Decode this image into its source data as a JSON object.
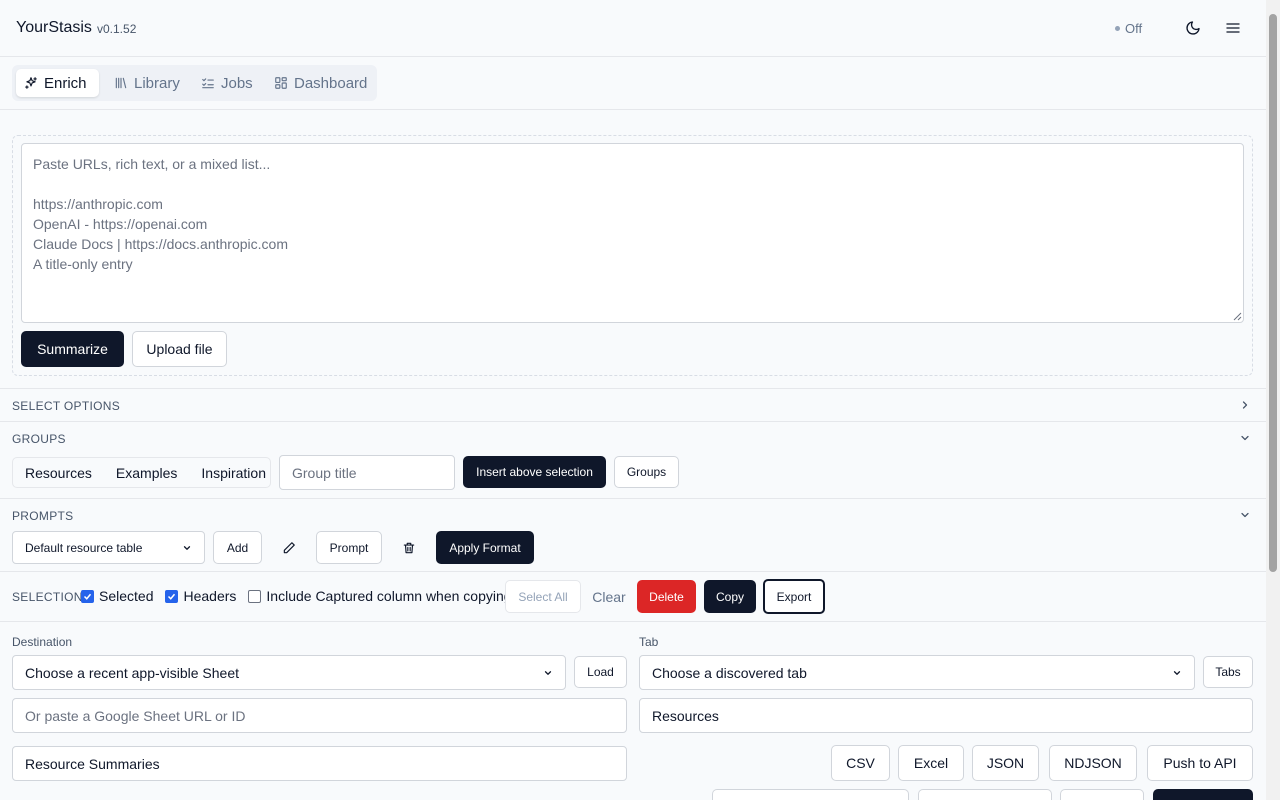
{
  "app": {
    "name": "YourStasis",
    "version": "v0.1.52",
    "status": "Off"
  },
  "nav": {
    "tabs": [
      {
        "label": "Enrich"
      },
      {
        "label": "Library"
      },
      {
        "label": "Jobs"
      },
      {
        "label": "Dashboard"
      }
    ]
  },
  "input": {
    "placeholder": "Paste URLs, rich text, or a mixed list...\n\nhttps://anthropic.com\nOpenAI - https://openai.com\nClaude Docs | https://docs.anthropic.com\nA title-only entry",
    "summarize_label": "Summarize",
    "upload_label": "Upload file"
  },
  "select_options": {
    "title": "SELECT OPTIONS"
  },
  "groups": {
    "title": "GROUPS",
    "items": [
      "Resources",
      "Examples",
      "Inspiration"
    ],
    "title_placeholder": "Group title",
    "insert_label": "Insert above selection",
    "groups_label": "Groups"
  },
  "prompts": {
    "title": "PROMPTS",
    "selected": "Default resource table",
    "add_label": "Add",
    "prompt_label": "Prompt",
    "apply_label": "Apply Format"
  },
  "selection": {
    "title": "SELECTION",
    "selected_label": "Selected",
    "headers_label": "Headers",
    "captured_label": "Include Captured column when copying",
    "select_all_label": "Select All",
    "clear_label": "Clear",
    "delete_label": "Delete",
    "copy_label": "Copy",
    "export_label": "Export"
  },
  "export": {
    "destination_label": "Destination",
    "destination_select": "Choose a recent app-visible Sheet",
    "load_label": "Load",
    "sheet_placeholder": "Or paste a Google Sheet URL or ID",
    "sheet_title": "Resource Summaries",
    "tab_label": "Tab",
    "tab_select": "Choose a discovered tab",
    "tabs_label": "Tabs",
    "tab_value": "Resources",
    "formats": [
      "CSV",
      "Excel",
      "JSON",
      "NDJSON",
      "Push to API"
    ]
  },
  "colors": {
    "primary": "#0f172a",
    "danger": "#dc2626",
    "checkbox": "#2563eb",
    "muted": "#64748b"
  }
}
